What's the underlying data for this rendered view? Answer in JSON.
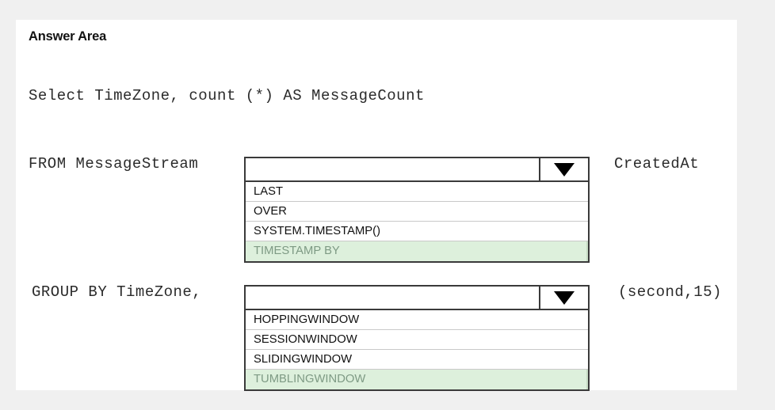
{
  "page": {
    "title": "Answer Area",
    "background_color": "#f0f0f0",
    "card_color": "#ffffff",
    "highlight_color": "#ddf0dc",
    "highlight_text_color": "#7e9a84"
  },
  "query": {
    "select_line": "Select TimeZone, count (*) AS MessageCount",
    "rows": [
      {
        "label": "FROM MessageStream",
        "suffix": "CreatedAt",
        "combo": {
          "value": "",
          "placeholder": "",
          "arrow_icon": "chevron-down-icon",
          "options": [
            {
              "label": "LAST",
              "selected": false
            },
            {
              "label": "OVER",
              "selected": false
            },
            {
              "label": "SYSTEM.TIMESTAMP()",
              "selected": false
            },
            {
              "label": "TIMESTAMP BY",
              "selected": true
            }
          ]
        }
      },
      {
        "label": "GROUP BY TimeZone,",
        "suffix": "(second,15)",
        "combo": {
          "value": "",
          "placeholder": "",
          "arrow_icon": "chevron-down-icon",
          "options": [
            {
              "label": "HOPPINGWINDOW",
              "selected": false
            },
            {
              "label": "SESSIONWINDOW",
              "selected": false
            },
            {
              "label": "SLIDINGWINDOW",
              "selected": false
            },
            {
              "label": "TUMBLINGWINDOW",
              "selected": true
            }
          ]
        }
      }
    ]
  }
}
